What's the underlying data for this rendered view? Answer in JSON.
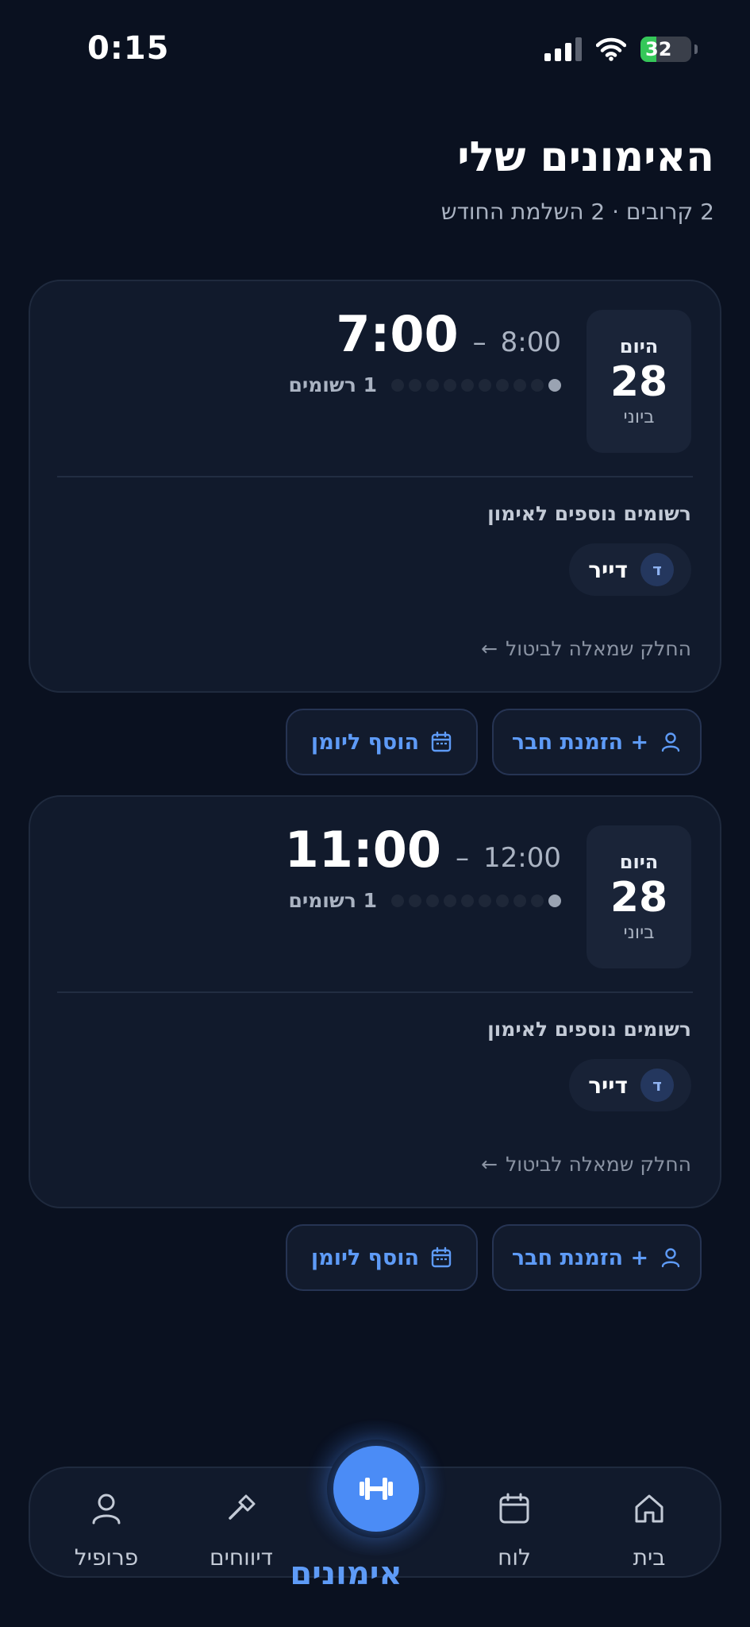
{
  "status_bar": {
    "time": "0:15",
    "battery": "32"
  },
  "header": {
    "title": "האימונים שלי",
    "subtitle": "2 קרובים · 2 השלמת החודש"
  },
  "sessions": [
    {
      "day_label": "היום",
      "day_num": "28",
      "month": "ביוני",
      "start": "7:00",
      "end": "8:00",
      "dash": "–",
      "registered_count": 1,
      "capacity": 10,
      "registered_text": "1 רשומים",
      "more_title": "רשומים נוספים לאימון",
      "member_initial": "ד",
      "member_name": "דייר",
      "swipe_hint": "החלק שמאלה לביטול",
      "invite_label": "+ הזמנת חבר",
      "calendar_label": "הוסף ליומן"
    },
    {
      "day_label": "היום",
      "day_num": "28",
      "month": "ביוני",
      "start": "11:00",
      "end": "12:00",
      "dash": "–",
      "registered_count": 1,
      "capacity": 10,
      "registered_text": "1 רשומים",
      "more_title": "רשומים נוספים לאימון",
      "member_initial": "ד",
      "member_name": "דייר",
      "swipe_hint": "החלק שמאלה לביטול",
      "invite_label": "+ הזמנת חבר",
      "calendar_label": "הוסף ליומן"
    }
  ],
  "bottom_nav": {
    "home": "בית",
    "board": "לוח",
    "workouts": "אימונים",
    "reports": "דיווחים",
    "profile": "פרופיל"
  },
  "icons": {
    "swipe_arrow": "←",
    "home": "home-icon",
    "board": "calendar-icon",
    "workouts": "dumbbell-icon",
    "reports": "hammer-icon",
    "profile": "user-icon"
  },
  "colors": {
    "accent": "#4b8cf6",
    "background": "#0a1120",
    "card": "#111a2c"
  }
}
